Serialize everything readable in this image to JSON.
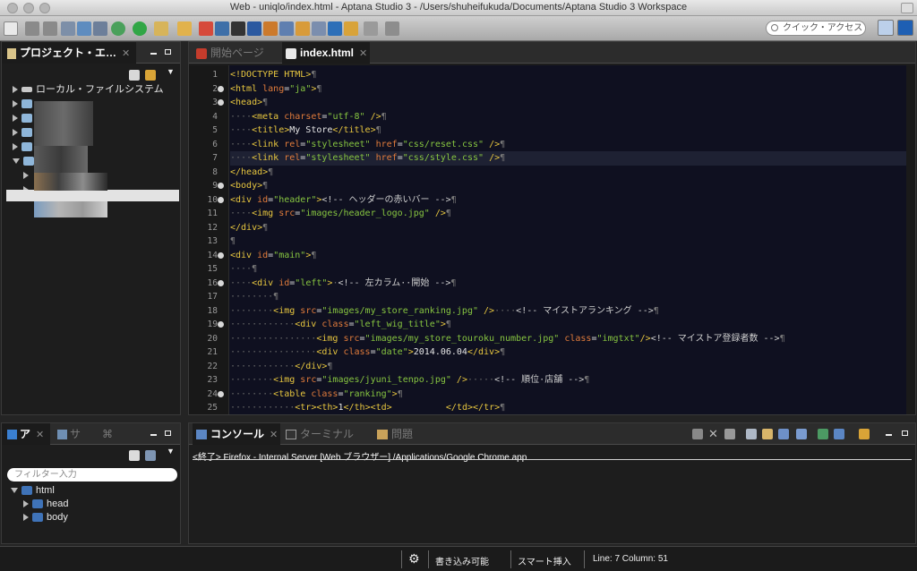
{
  "window": {
    "title": "Web - uniqlo/index.html - Aptana Studio 3 - /Users/shuheifukuda/Documents/Aptana Studio 3 Workspace"
  },
  "toolbar": {
    "quick_access_placeholder": "クイック・アクセス"
  },
  "project_explorer": {
    "tab_label": "プロジェクト・エ…",
    "root_item": "ローカル・ファイルシステム"
  },
  "editor": {
    "tabs": [
      {
        "label": "開始ページ",
        "active": false
      },
      {
        "label": "index.html",
        "active": true
      }
    ],
    "current_line": 7,
    "lines": [
      "<!DOCTYPE HTML>¶",
      "<html lang=\"ja\">¶",
      "<head>¶",
      "····<meta charset=\"utf-8\" />¶",
      "····<title>My Store</title>¶",
      "····<link rel=\"stylesheet\" href=\"css/reset.css\" />¶",
      "····<link rel=\"stylesheet\" href=\"css/style.css\" />¶",
      "</head>¶",
      "<body>¶",
      "<div id=\"header\"><!-- ヘッダーの赤いバー -->¶",
      "····<img src=\"images/header_logo.jpg\" />¶",
      "</div>¶",
      "¶",
      "<div id=\"main\">¶",
      "····¶",
      "····<div id=\"left\">·<!-- 左カラム··開始 -->¶",
      "········¶",
      "········<img src=\"images/my_store_ranking.jpg\" />····<!-- マイストアランキング -->¶",
      "············<div class=\"left_wig_title\">¶",
      "················<img src=\"images/my_store_touroku_number.jpg\" class=\"imgtxt\"/><!-- マイストア登録者数 -->¶",
      "················<div class=\"date\">2014.06.04</div>¶",
      "············</div>¶",
      "········<img src=\"images/jyuni_tenpo.jpg\" />·····<!-- 順位·店舗 -->¶",
      "········<table class=\"ranking\">¶",
      "············<tr><th>1</th><td>          </td></tr>¶"
    ],
    "line_numbers": [
      "1",
      "2",
      "3",
      "4",
      "5",
      "6",
      "7",
      "8",
      "9",
      "10",
      "11",
      "12",
      "13",
      "14",
      "15",
      "16",
      "17",
      "18",
      "19",
      "20",
      "21",
      "22",
      "23",
      "24",
      "25"
    ]
  },
  "outline": {
    "tabs": [
      {
        "label": "ア"
      },
      {
        "label": "サ"
      }
    ],
    "filter_placeholder": "フィルター入力",
    "tree": [
      {
        "label": "html",
        "level": 0,
        "expanded": true
      },
      {
        "label": "head",
        "level": 1,
        "expanded": false
      },
      {
        "label": "body",
        "level": 1,
        "expanded": false
      }
    ]
  },
  "console": {
    "tabs": [
      {
        "label": "コンソール",
        "active": true
      },
      {
        "label": "ターミナル",
        "active": false
      },
      {
        "label": "問題",
        "active": false
      }
    ],
    "output": "<終了> Firefox - Internal Server [Web ブラウザー] /Applications/Google Chrome.app"
  },
  "status": {
    "writable": "書き込み可能",
    "insert_mode": "スマート挿入",
    "position": "Line: 7 Column: 51"
  },
  "colors": {
    "tag": "#e7c63f",
    "attr": "#e07b3b",
    "string": "#86c440",
    "text": "#e6e6e6",
    "comment": "#cfcfcf",
    "editor_bg": "#0f1020"
  }
}
